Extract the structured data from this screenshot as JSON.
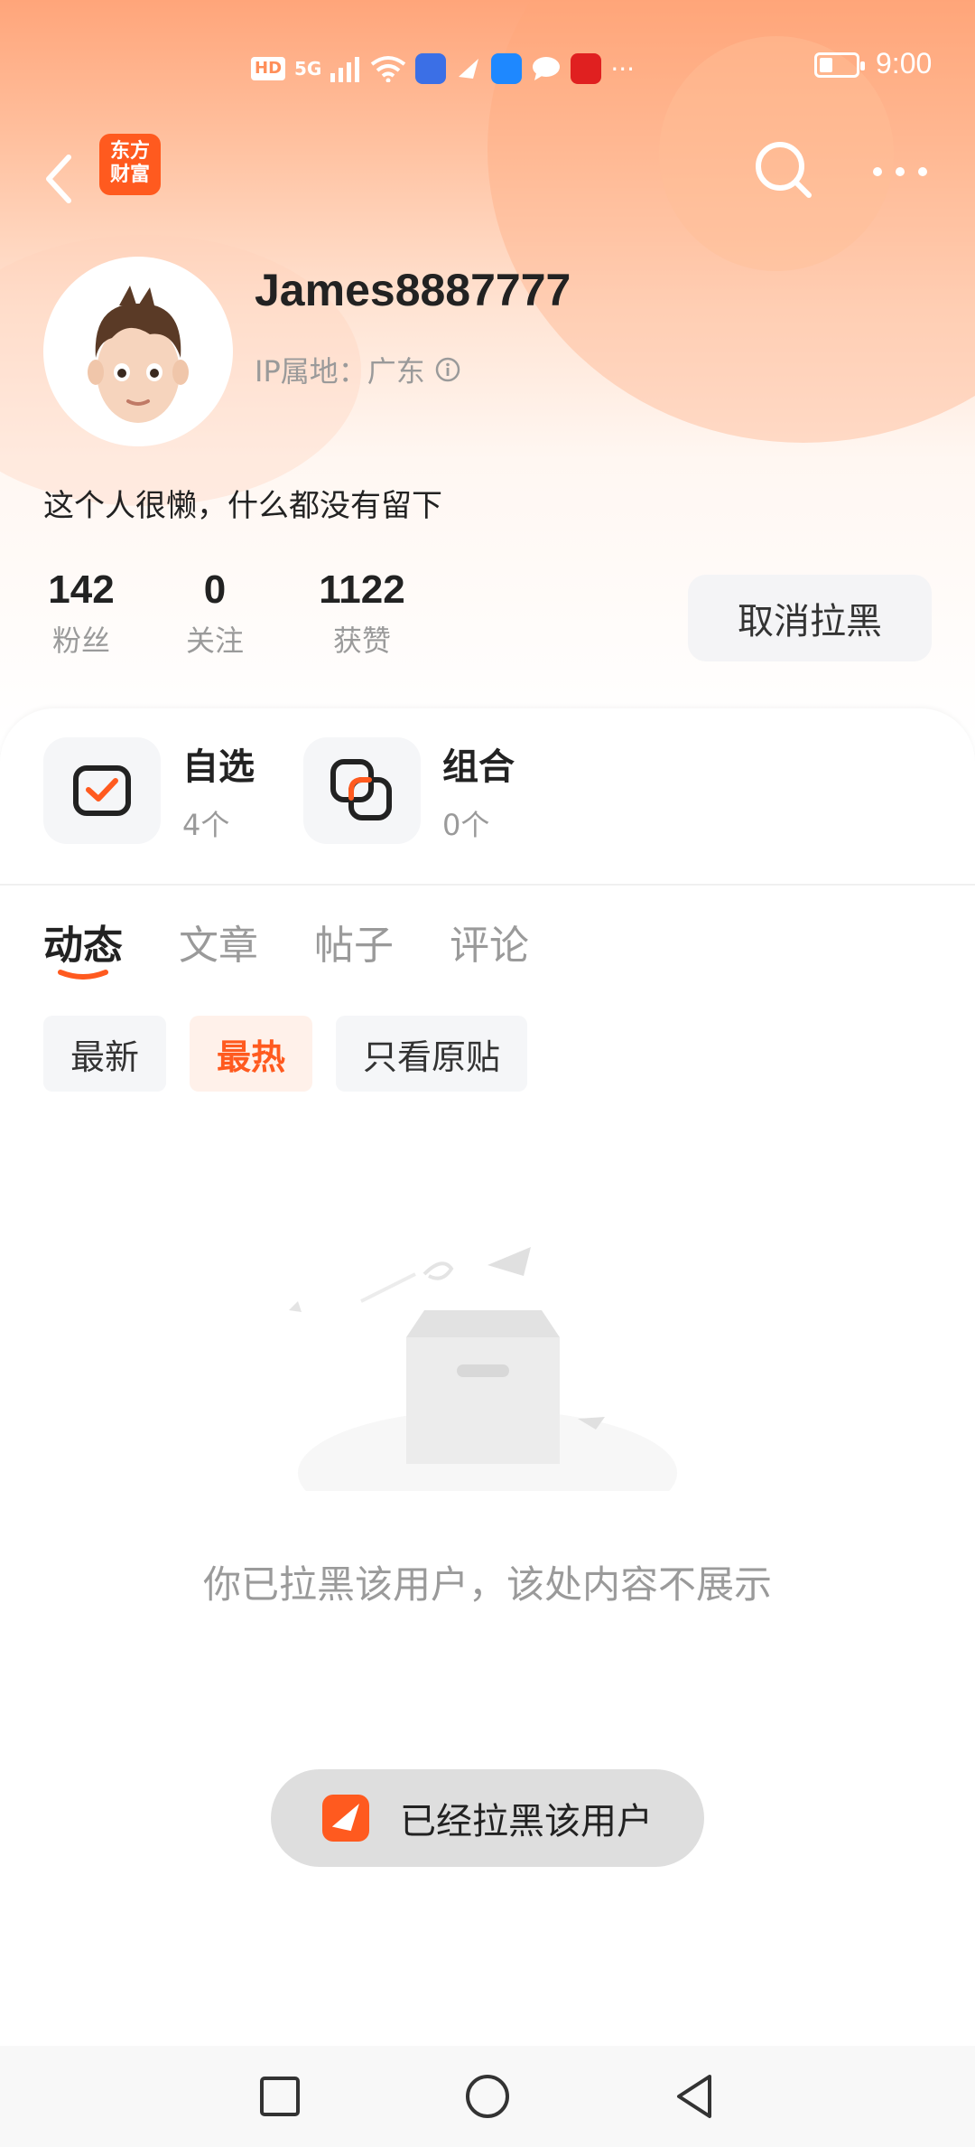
{
  "status_bar": {
    "time": "9:00",
    "hd_label": "HD",
    "network_label": "5G",
    "icons": [
      "signal-icon",
      "wifi-icon",
      "app-notification-icons",
      "more-notifications-icon",
      "battery-icon"
    ]
  },
  "header": {
    "logo_text_line1": "东方",
    "logo_text_line2": "财富",
    "icons": [
      "back-icon",
      "search-icon",
      "more-icon"
    ]
  },
  "profile": {
    "username": "James8887777",
    "ip_location": "IP属地：广东",
    "bio": "这个人很懒，什么都没有留下",
    "stats": [
      {
        "value": "142",
        "label": "粉丝"
      },
      {
        "value": "0",
        "label": "关注"
      },
      {
        "value": "1122",
        "label": "获赞"
      }
    ],
    "unblock_label": "取消拉黑"
  },
  "quick_access": [
    {
      "title": "自选",
      "count": "4个",
      "icon": "checkbox-icon"
    },
    {
      "title": "组合",
      "count": "0个",
      "icon": "portfolio-icon"
    }
  ],
  "tabs": [
    {
      "label": "动态",
      "active": true
    },
    {
      "label": "文章",
      "active": false
    },
    {
      "label": "帖子",
      "active": false
    },
    {
      "label": "评论",
      "active": false
    }
  ],
  "filters": [
    {
      "label": "最新",
      "active": false
    },
    {
      "label": "最热",
      "active": true
    },
    {
      "label": "只看原贴",
      "active": false
    }
  ],
  "empty_state": {
    "message": "你已拉黑该用户，该处内容不展示"
  },
  "toast": {
    "message": "已经拉黑该用户"
  },
  "colors": {
    "accent": "#ff5a1f",
    "hero_top": "#ffa57a",
    "muted_text": "#9a9a9a"
  }
}
